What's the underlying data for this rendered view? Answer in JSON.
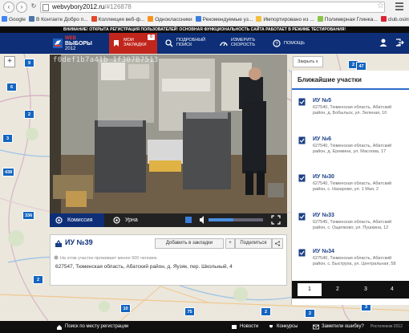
{
  "browser": {
    "url_host": "webvybory2012.ru",
    "url_path": "/#126878",
    "bookmarks": [
      {
        "label": "Google",
        "color": "#4285f4"
      },
      {
        "label": "В Контакте Добро п...",
        "color": "#4a76a8"
      },
      {
        "label": "Коллекция веб-ф...",
        "color": "#e04a2a"
      },
      {
        "label": "Одноклассники",
        "color": "#f7931e"
      },
      {
        "label": "Рекомендуемые уз...",
        "color": "#3b7ddd"
      },
      {
        "label": "Импортировано из ...",
        "color": "#f0c040"
      },
      {
        "label": "Полимерная Глинка...",
        "color": "#8bc34a"
      },
      {
        "label": "club.osinka.ru : Ле...",
        "color": "#d23"
      }
    ]
  },
  "site": {
    "warning": "ВНИМАНИЕ! ОТКРЫТА РЕГИСТРАЦИЯ ПОЛЬЗОВАТЕЛЕЙ! ОСНОВНАЯ ФУНКЦИОНАЛЬНОСТЬ САЙТА РАБОТАЕТ В РЕЖИМЕ ТЕСТИРОВАНИЯ!",
    "logo_line1": "WEB",
    "logo_line2": "ВЫБОРЫ",
    "logo_line3": "2012",
    "nav": {
      "bookmarks_line1": "МОИ",
      "bookmarks_line2": "ЗАКЛАДКИ",
      "bookmarks_count": "0",
      "search_line1": "ПОДРОБНЫЙ",
      "search_line2": "ПОИСК",
      "speed_line1": "ИЗМЕРИТЬ",
      "speed_line2": "СКОРОСТЬ",
      "help": "ПОМОЩЬ"
    },
    "accent_color": "#c0261c",
    "brand_color": "#0e2f78"
  },
  "map": {
    "markers": [
      "9",
      "2",
      "47",
      "6",
      "2",
      "3",
      "438",
      "336",
      "75",
      "73",
      "10",
      "75",
      "2",
      "2",
      "3",
      "2"
    ]
  },
  "camera": {
    "overlay_id": "f0def1b7a41b 1f307B7513",
    "tab_commission": "Комиссия",
    "tab_urn": "Урна",
    "volume_fraction": 0.45
  },
  "station": {
    "title": "ИУ №39",
    "add_bookmark": "Добавить в закладки",
    "plus": "+",
    "share": "Поделиться",
    "note": "На этом участке проживает менее 500 человек.",
    "address": "627547, Тюменская область, Абатский район, д. Яузяк, пер. Школьный, 4"
  },
  "nearby": {
    "close_label": "Закрыть",
    "close_x": "x",
    "title": "Ближайшие участки",
    "items": [
      {
        "name": "ИУ №5",
        "address": "627540, Тюменская область, Абатский район, д. Бобыльск, ул. Зеленая, 10"
      },
      {
        "name": "ИУ №6",
        "address": "627540, Тюменская область, Абатский район, д. Еремина, ул. Маслова, 17"
      },
      {
        "name": "ИУ №30",
        "address": "627540, Тюменская область, Абатский район, с. Назарово, ул. 1 Мая, 2"
      },
      {
        "name": "ИУ №33",
        "address": "627545, Тюменская область, Абатский район, с. Ощепково, ул. Пушкина, 12"
      },
      {
        "name": "ИУ №34",
        "address": "627540, Тюменская область, Абатский район, с. Быструха, ул. Центральная, 58"
      }
    ],
    "pages": [
      "1",
      "2",
      "3",
      "4"
    ],
    "current_page": "1"
  },
  "footer": {
    "search": "Поиск по месту регистрации",
    "news": "Новости",
    "contests": "Конкурсы",
    "report": "Заметили ошибку?",
    "copyright": "Ростелеком 2012"
  }
}
